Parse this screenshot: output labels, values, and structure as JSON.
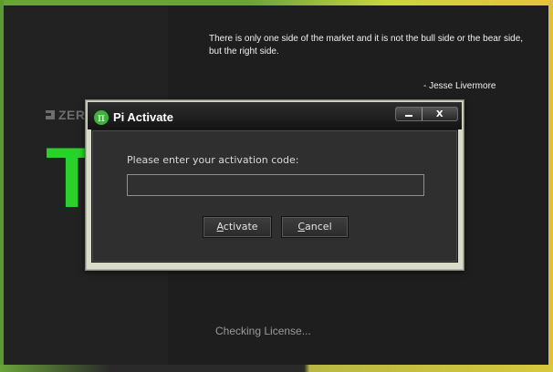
{
  "splash": {
    "quote": "There is only one side of the market and it is not the bull side or the bear side, but the right side.",
    "quote_author": "- Jesse Livermore",
    "brand_text": "ZER",
    "big_logo": "T",
    "status": "Checking License..."
  },
  "dialog": {
    "title": "Pi Activate",
    "app_icon_glyph": "π",
    "prompt": "Please enter your activation code:",
    "code_value": "",
    "activate_accel": "A",
    "activate_rest": "ctivate",
    "cancel_accel": "C",
    "cancel_rest": "ancel",
    "minimize_icon": "minimize-icon",
    "close_glyph": "X"
  },
  "colors": {
    "accent_green": "#2bd12b",
    "dialog_frame": "#d8dcc9",
    "content_bg": "#2f2f2f"
  }
}
